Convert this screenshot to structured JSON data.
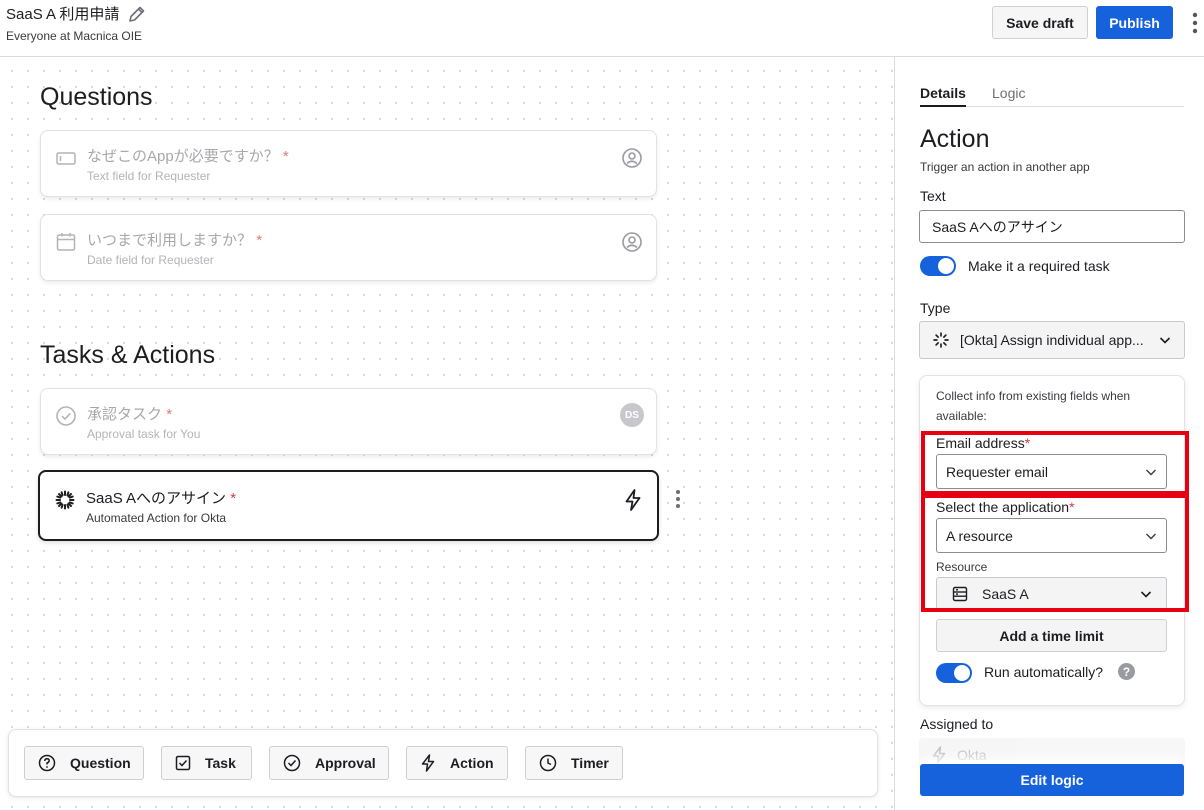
{
  "header": {
    "title": "SaaS A 利用申請",
    "subtitle": "Everyone at Macnica OIE",
    "save_draft_label": "Save draft",
    "publish_label": "Publish"
  },
  "canvas": {
    "questions_title": "Questions",
    "questions": [
      {
        "title": "なぜこのAppが必要ですか？",
        "required_mark": "*",
        "subtitle": "Text field for Requester",
        "icon": "text-field-icon"
      },
      {
        "title": "いつまで利用しますか？",
        "required_mark": "*",
        "subtitle": "Date field for Requester",
        "icon": "calendar-icon"
      }
    ],
    "tasks_title": "Tasks & Actions",
    "tasks": [
      {
        "title": "承認タスク",
        "required_mark": "*",
        "subtitle": "Approval task for You",
        "badge": "DS",
        "icon": "check-circle-icon"
      },
      {
        "title": "SaaS Aへのアサイン",
        "required_mark": "*",
        "subtitle": "Automated Action for Okta",
        "icon": "okta-icon"
      }
    ]
  },
  "toolbar": {
    "buttons": [
      {
        "label": "Question",
        "icon": "question-circle-icon"
      },
      {
        "label": "Task",
        "icon": "checkbox-icon"
      },
      {
        "label": "Approval",
        "icon": "check-circle-icon"
      },
      {
        "label": "Action",
        "icon": "lightning-icon"
      },
      {
        "label": "Timer",
        "icon": "clock-icon"
      }
    ]
  },
  "panel": {
    "tabs": [
      "Details",
      "Logic"
    ],
    "title": "Action",
    "subtitle": "Trigger an action in another app",
    "text_label": "Text",
    "text_value": "SaaS Aへのアサイン",
    "required_toggle_label": "Make it a required task",
    "type_label": "Type",
    "type_value": "[Okta] Assign individual app...",
    "collect_info": "Collect info from existing fields when available:",
    "email_label": "Email address",
    "email_value": "Requester email",
    "app_label": "Select the application",
    "app_value": "A resource",
    "resource_label": "Resource",
    "resource_value": "SaaS A",
    "add_time_limit": "Add a time limit",
    "run_auto_label": "Run automatically?",
    "assigned_label": "Assigned to",
    "assigned_value": "Okta",
    "edit_logic": "Edit logic",
    "required_mark": "*"
  },
  "colors": {
    "accent": "#1662dd",
    "highlight": "#e60012",
    "required": "#d9363e"
  }
}
